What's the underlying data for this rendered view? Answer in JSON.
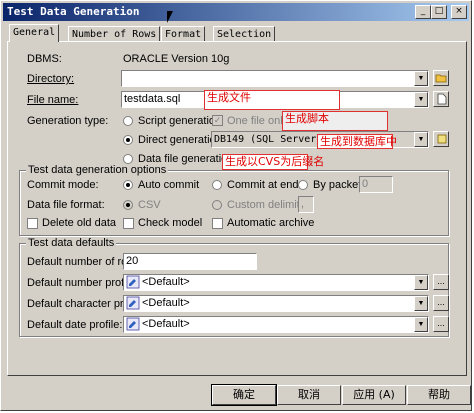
{
  "window": {
    "title": "Test Data Generation",
    "buttons": {
      "minimize": "_",
      "maximize": "□",
      "close": "×"
    }
  },
  "tabs": [
    "General",
    "Number of Rows",
    "Format",
    "Selection"
  ],
  "general": {
    "dbms_label": "DBMS:",
    "dbms_value": "ORACLE Version 10g",
    "directory_label": "Directory:",
    "directory_value": "",
    "file_label": "File name:",
    "file_value": "testdata.sql",
    "gen_type_label": "Generation type:",
    "script_gen": "Script generation",
    "one_file_only": "One file only",
    "direct_gen": "Direct generation:",
    "direct_source": "DB149 (SQL Server)",
    "datafile_gen": "Data file generation"
  },
  "options": {
    "group_title": "Test data generation options",
    "commit_mode_label": "Commit mode:",
    "auto_commit": "Auto commit",
    "commit_at_end": "Commit at end",
    "by_packet": "By packet:",
    "packet_value": "0",
    "format_label": "Data file format:",
    "csv": "CSV",
    "custom_delim": "Custom delimiter:",
    "delim_value": ",",
    "delete_old": "Delete old data",
    "check_model": "Check model",
    "auto_archive": "Automatic archive"
  },
  "defaults": {
    "group_title": "Test data defaults",
    "rows_label": "Default number of rows:",
    "rows_value": "20",
    "number_label": "Default number profile:",
    "number_value": "<Default>",
    "char_label": "Default character profile:",
    "char_value": "<Default>",
    "date_label": "Default date profile:",
    "date_value": "<Default>",
    "ellipsis": "..."
  },
  "annotations": {
    "file": "生成文件",
    "script": "生成脚本",
    "direct": "生成到数据库中",
    "datafile": "生成以CVS为后缀名"
  },
  "footer": {
    "ok": "确定",
    "cancel": "取消",
    "apply": "应用 (A)",
    "help": "帮助"
  }
}
